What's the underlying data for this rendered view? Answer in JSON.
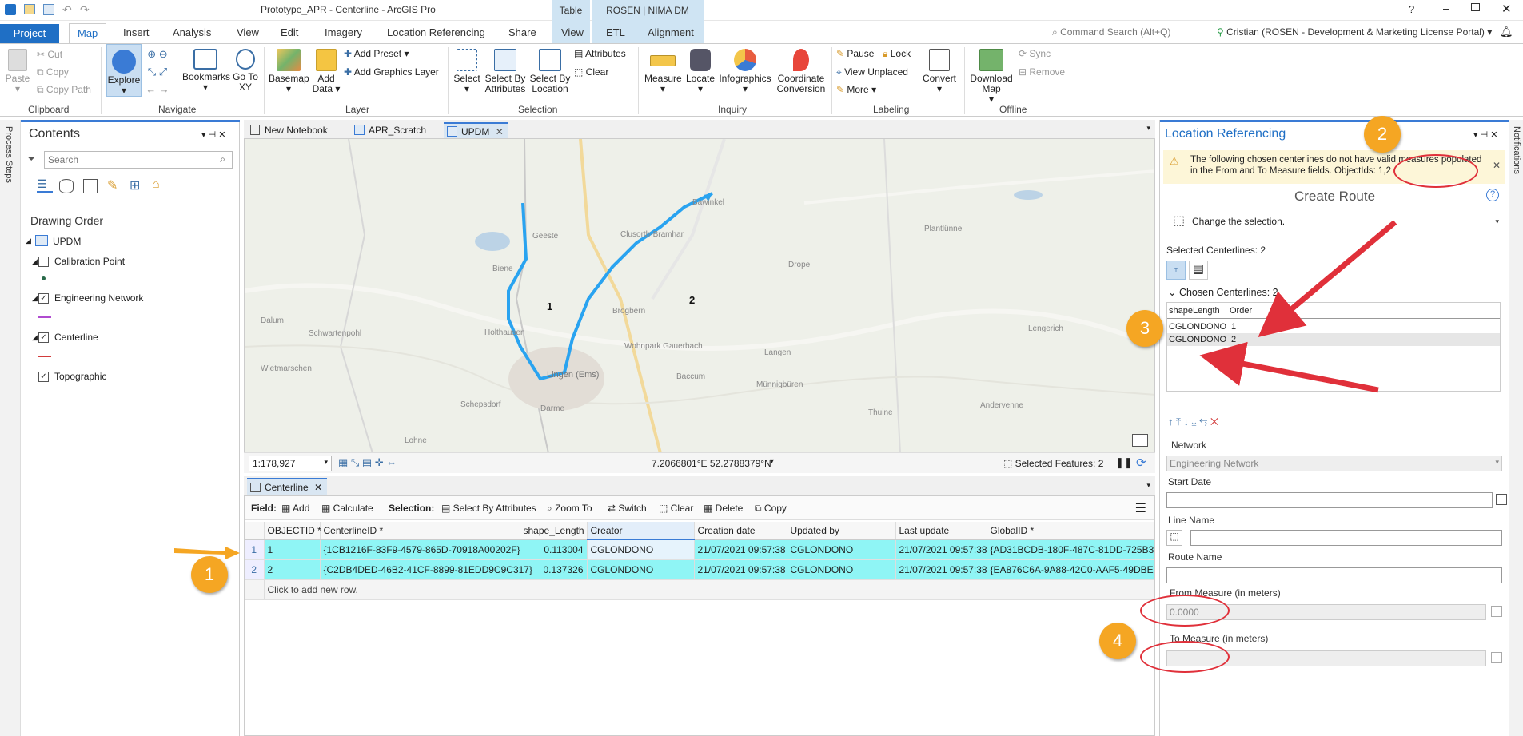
{
  "window": {
    "title": "Prototype_APR - Centerline - ArcGIS Pro",
    "help": "?"
  },
  "context_tabs": {
    "table": "Table",
    "rosen": "ROSEN | NIMA DM"
  },
  "tabs": [
    "Project",
    "Map",
    "Insert",
    "Analysis",
    "View",
    "Edit",
    "Imagery",
    "Location Referencing",
    "Share",
    "View",
    "ETL",
    "Alignment"
  ],
  "command_search": {
    "placeholder": "Command Search (Alt+Q)"
  },
  "user": "Cristian (ROSEN - Development & Marketing License Portal)",
  "ribbon": {
    "clipboard": {
      "paste": "Paste",
      "cut": "Cut",
      "copy": "Copy",
      "copy_path": "Copy Path",
      "label": "Clipboard"
    },
    "navigate": {
      "explore": "Explore",
      "bookmarks": "Bookmarks",
      "goto": "Go To XY",
      "label": "Navigate"
    },
    "layer": {
      "basemap": "Basemap",
      "add_data": "Add Data",
      "add_preset": "Add Preset",
      "add_graphics": "Add Graphics Layer",
      "label": "Layer"
    },
    "selection": {
      "select": "Select",
      "by_attr": "Select By Attributes",
      "by_loc": "Select By Location",
      "attributes": "Attributes",
      "clear": "Clear",
      "label": "Selection"
    },
    "inquiry": {
      "measure": "Measure",
      "locate": "Locate",
      "infographics": "Infographics",
      "coord": "Coordinate Conversion",
      "label": "Inquiry"
    },
    "labeling": {
      "pause": "Pause",
      "lock": "Lock",
      "view_unplaced": "View Unplaced",
      "more": "More",
      "convert": "Convert",
      "label": "Labeling"
    },
    "offline": {
      "download": "Download Map",
      "sync": "Sync",
      "remove": "Remove",
      "label": "Offline"
    }
  },
  "left_strip": "Process Steps",
  "contents": {
    "title": "Contents",
    "search_placeholder": "Search",
    "drawing_order": "Drawing Order",
    "map_name": "UPDM",
    "layers": [
      {
        "name": "Calibration Point",
        "checked": false
      },
      {
        "name": "Engineering Network",
        "checked": true
      },
      {
        "name": "Centerline",
        "checked": true
      },
      {
        "name": "Topographic",
        "checked": true
      }
    ]
  },
  "view_tabs": [
    "New Notebook",
    "APR_Scratch",
    "UPDM"
  ],
  "map": {
    "labels": [
      "1",
      "2"
    ],
    "towns": [
      "Schepsdorf",
      "Lingen (Ems)",
      "Darme",
      "Holthausen",
      "Biene",
      "Brögbern",
      "Bawinkel",
      "Langen",
      "Clusorth-Bramhar",
      "Wohnpark Gauerbach",
      "Baccum",
      "Münnigbüren",
      "Thuine",
      "Andervenne",
      "Lohne",
      "Drope",
      "Schwartenpohl",
      "Wietmarschen",
      "Dalum",
      "Lengerich",
      "Plantlünne",
      "Geeste"
    ],
    "scale": "1:178,927",
    "coords": "7.2066801°E 52.2788379°N",
    "selected": "Selected Features: 2"
  },
  "attribute_table": {
    "tab": "Centerline",
    "field_label": "Field:",
    "add": "Add",
    "calculate": "Calculate",
    "selection_label": "Selection:",
    "select_by_attr": "Select By Attributes",
    "zoom_to": "Zoom To",
    "switch": "Switch",
    "clear": "Clear",
    "delete": "Delete",
    "copy": "Copy",
    "columns": [
      "OBJECTID *",
      "CenterlineID *",
      "shape_Length",
      "Creator",
      "Creation date",
      "Updated by",
      "Last update",
      "GlobalID *"
    ],
    "rows": [
      [
        "1",
        "{1CB1216F-83F9-4579-865D-70918A00202F}",
        "0.113004",
        "CGLONDONO",
        "21/07/2021 09:57:38",
        "CGLONDONO",
        "21/07/2021 09:57:38",
        "{AD31BCDB-180F-487C-81DD-725B3"
      ],
      [
        "2",
        "{C2DB4DED-46B2-41CF-8899-81EDD9C9C317}",
        "0.137326",
        "CGLONDONO",
        "21/07/2021 09:57:38",
        "CGLONDONO",
        "21/07/2021 09:57:38",
        "{EA876C6A-9A88-42C0-AAF5-49DBE"
      ]
    ],
    "new_row": "Click to add new row."
  },
  "lr_panel": {
    "title": "Location Referencing",
    "warning": "The following chosen centerlines do not have valid measures populated in the From and To Measure fields. ObjectIds: 1,2",
    "create_route": "Create Route",
    "change_selection": "Change the selection.",
    "selected_centerlines": "Selected Centerlines: 2",
    "chosen_centerlines": "Chosen Centerlines: 2",
    "grid_cols": [
      "shapeLength",
      "Order"
    ],
    "grid_rows": [
      [
        "CGLONDONO",
        "1"
      ],
      [
        "CGLONDONO",
        "2"
      ]
    ],
    "network_label": "Network",
    "network_value": "Engineering Network",
    "start_date": "Start Date",
    "line_name": "Line Name",
    "route_name": "Route Name",
    "from_measure": "From Measure (in meters)",
    "from_value": "0.0000",
    "to_measure": "To Measure (in meters)"
  },
  "right_strip": "Notifications",
  "callouts": [
    "1",
    "2",
    "3",
    "4"
  ],
  "colors": {
    "accent": "#1f6fc5",
    "selection": "#8ff5f5",
    "route": "#29a3f0",
    "callout": "#f5a623",
    "annotation": "#e0303a"
  }
}
